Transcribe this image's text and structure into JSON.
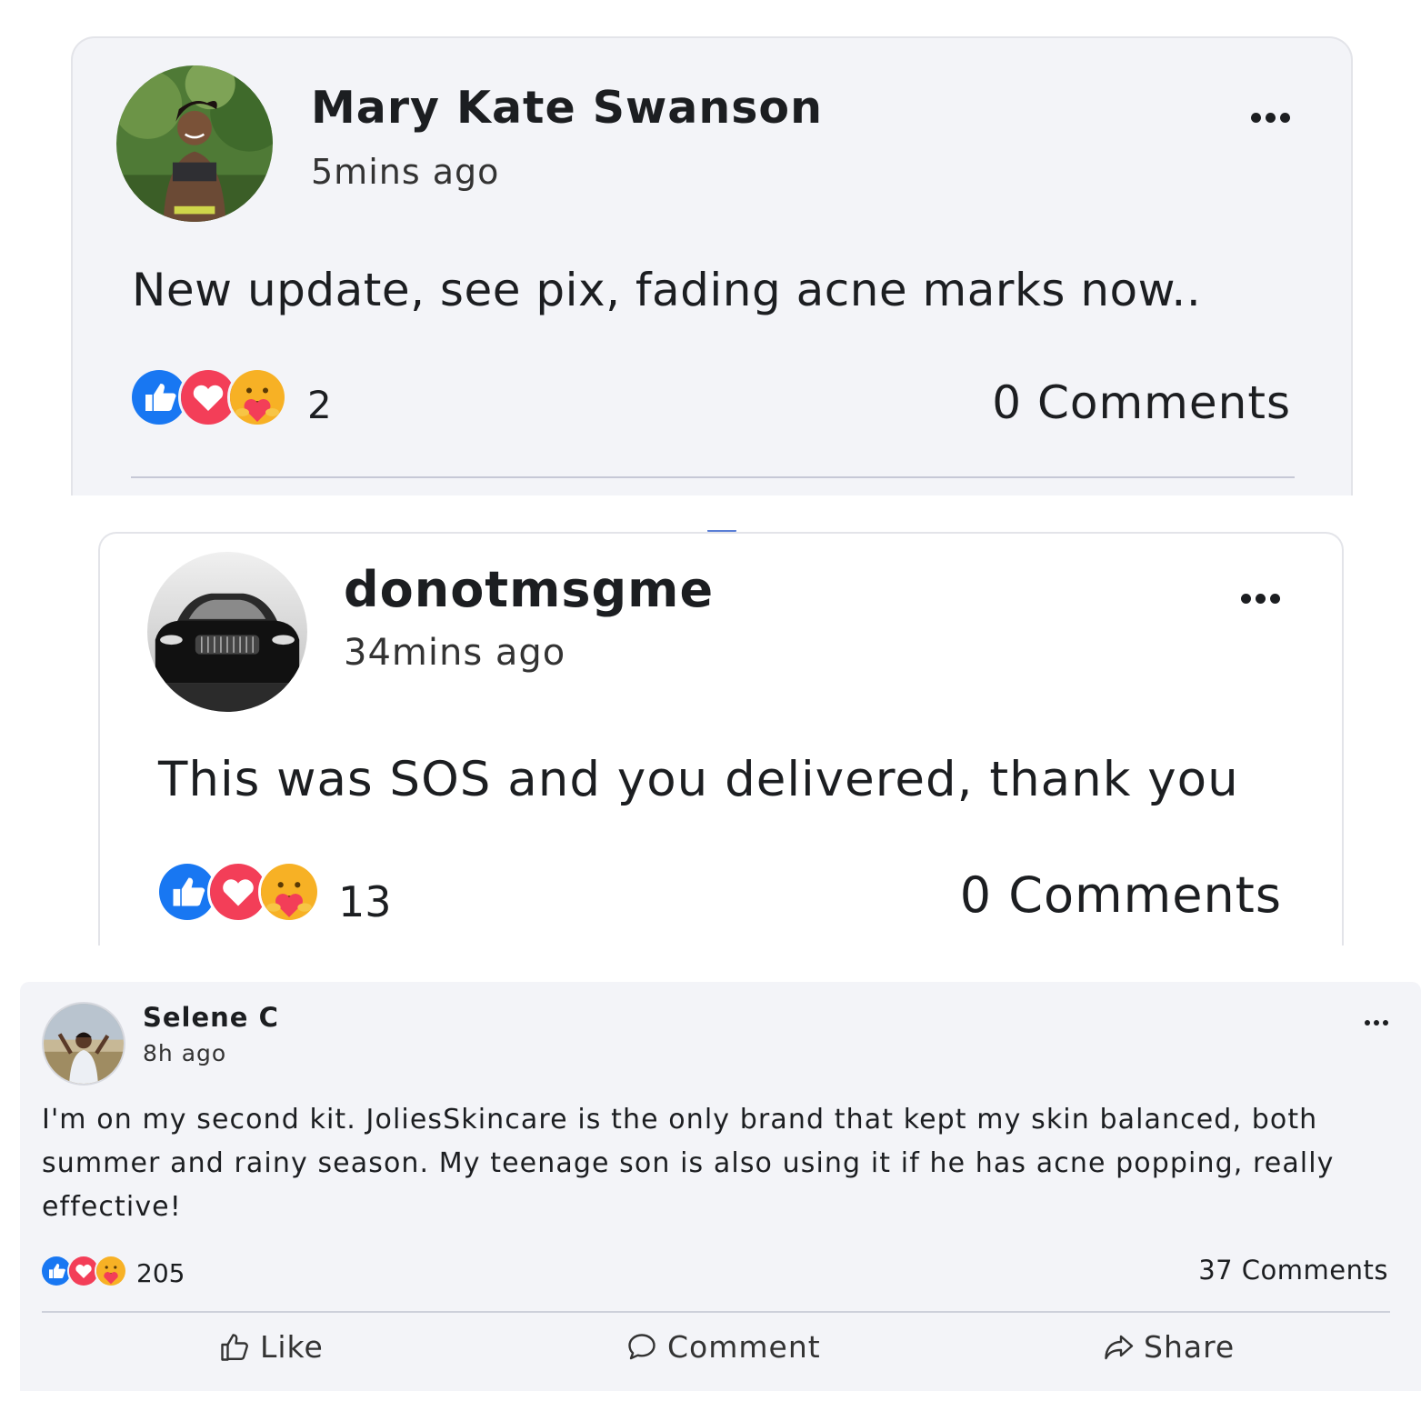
{
  "posts": [
    {
      "author": "Mary Kate Swanson",
      "time": "5mins ago",
      "text": "New update, see pix, fading acne marks now..",
      "reaction_count": "2",
      "comments": "0 Comments"
    },
    {
      "author": "donotmsgme",
      "time": "34mins ago",
      "text": "This was SOS and you delivered, thank you",
      "reaction_count": "13",
      "comments": "0 Comments"
    },
    {
      "author": "Selene C",
      "time": "8h ago",
      "text_lines": [
        "I'm on my second kit. JoliesSkincare is the only brand that kept my skin balanced, both",
        "summer and rainy season. My teenage son is also using it if he has acne popping, really",
        "effective!"
      ],
      "reaction_count": "205",
      "comments": "37 Comments",
      "actions": {
        "like": "Like",
        "comment": "Comment",
        "share": "Share"
      }
    }
  ],
  "icons": {
    "like": "thumbs-up-icon",
    "love": "heart-icon",
    "care": "care-emoji-icon",
    "more": "more-dots-icon",
    "comment": "speech-bubble-icon",
    "share": "share-arrow-icon"
  },
  "colors": {
    "like_blue": "#1877f2",
    "love_red": "#f33e58",
    "care_yellow": "#f7b125",
    "card_bg": "#f3f4f8"
  }
}
